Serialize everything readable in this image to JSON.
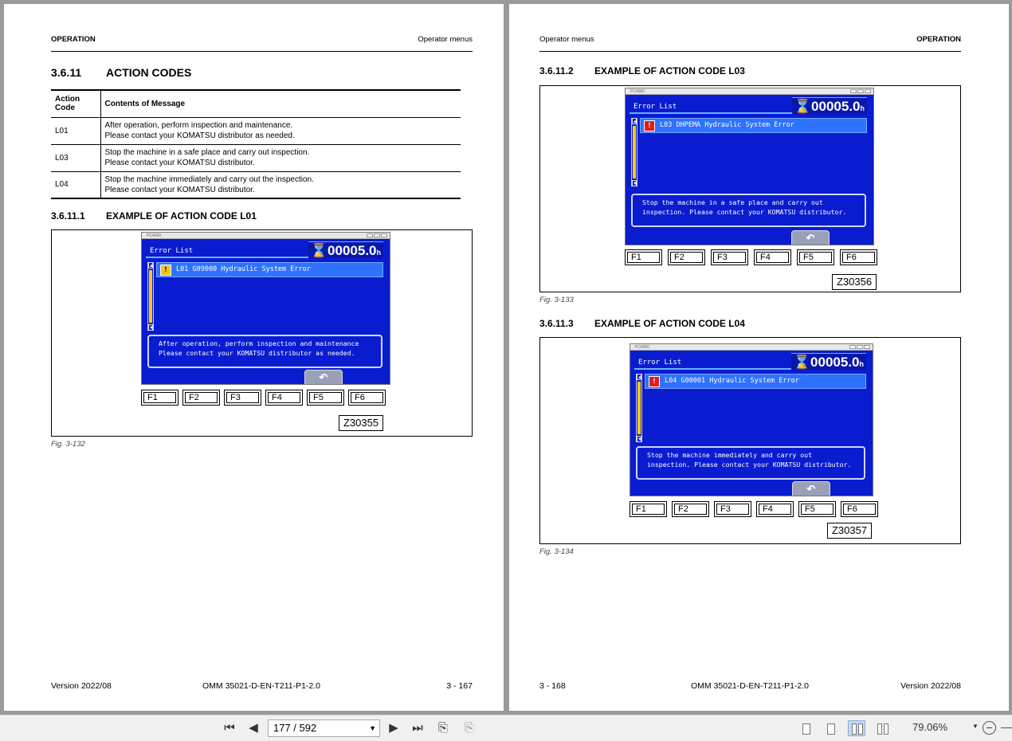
{
  "left_page": {
    "header_left": "OPERATION",
    "header_right": "Operator menus",
    "section_num": "3.6.11",
    "section_title": "ACTION CODES",
    "table": {
      "col1": "Action Code",
      "col2": "Contents of Message",
      "rows": [
        {
          "code": "L01",
          "line1": "After operation, perform inspection and maintenance.",
          "line2": "Please contact your KOMATSU distributor as needed."
        },
        {
          "code": "L03",
          "line1": "Stop the machine in a safe place and carry out inspection.",
          "line2": "Please contact your KOMATSU distributor."
        },
        {
          "code": "L04",
          "line1": "Stop the machine immediately and carry out the inspection.",
          "line2": "Please contact your KOMATSU distributor."
        }
      ]
    },
    "sub_num": "3.6.11.1",
    "sub_title": "EXAMPLE OF ACTION CODE L01",
    "figure": {
      "window_title": "PC4000",
      "list_title": "Error List",
      "hours": "00005.0",
      "hours_unit": "h",
      "error_item": "L01 G09000 Hydraulic System Error",
      "msg_line1": "After operation, perform inspection and maintenance",
      "msg_line2": "Please contact your KOMATSU distributor as needed.",
      "fig_id": "Z30355"
    },
    "caption": "Fig. 3-132",
    "footer_left": "Version 2022/08",
    "footer_center": "OMM 35021-D-EN-T211-P1-2.0",
    "footer_right": "3 - 167"
  },
  "right_page": {
    "header_left": "Operator menus",
    "header_right": "OPERATION",
    "sub1_num": "3.6.11.2",
    "sub1_title": "EXAMPLE OF ACTION CODE L03",
    "figure1": {
      "window_title": "PC4000",
      "list_title": "Error List",
      "hours": "00005.0",
      "hours_unit": "h",
      "error_item": "L03 DHPEMA Hydraulic System Error",
      "msg_line1": "Stop the machine in a safe place and carry out",
      "msg_line2": "inspection. Please contact your KOMATSU distributor.",
      "fig_id": "Z30356"
    },
    "caption1": "Fig. 3-133",
    "sub2_num": "3.6.11.3",
    "sub2_title": "EXAMPLE OF ACTION CODE L04",
    "figure2": {
      "window_title": "PC4000",
      "list_title": "Error List",
      "hours": "00005.0",
      "hours_unit": "h",
      "error_item": "L04 G00001 Hydraulic System Error",
      "msg_line1": "Stop the machine immediately and carry out",
      "msg_line2": "inspection. Please contact your KOMATSU distributor.",
      "fig_id": "Z30357"
    },
    "caption2": "Fig. 3-134",
    "footer_left": "3 - 168",
    "footer_center": "OMM 35021-D-EN-T211-P1-2.0",
    "footer_right": "Version 2022/08"
  },
  "fkeys": [
    "F1",
    "F2",
    "F3",
    "F4",
    "F5",
    "F6"
  ],
  "toolbar": {
    "page_indicator": "177 / 592",
    "zoom": "79.06%"
  }
}
